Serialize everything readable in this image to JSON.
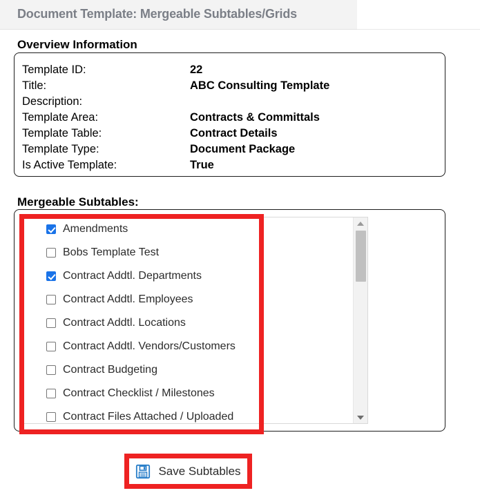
{
  "header": {
    "title": "Document Template: Mergeable Subtables/Grids"
  },
  "overview": {
    "legend": "Overview Information",
    "rows": [
      {
        "label": "Template ID:",
        "value": "22"
      },
      {
        "label": "Title:",
        "value": "ABC Consulting Template"
      },
      {
        "label": "Description:",
        "value": ""
      },
      {
        "label": "Template Area:",
        "value": "Contracts & Committals"
      },
      {
        "label": "Template Table:",
        "value": "Contract Details"
      },
      {
        "label": "Template Type:",
        "value": "Document Package"
      },
      {
        "label": "Is Active Template:",
        "value": "True"
      }
    ]
  },
  "subtables": {
    "legend": "Mergeable Subtables:",
    "items": [
      {
        "label": "Amendments",
        "checked": true
      },
      {
        "label": "Bobs Template Test",
        "checked": false
      },
      {
        "label": "Contract Addtl. Departments",
        "checked": true
      },
      {
        "label": "Contract Addtl. Employees",
        "checked": false
      },
      {
        "label": "Contract Addtl. Locations",
        "checked": false
      },
      {
        "label": "Contract Addtl. Vendors/Customers",
        "checked": false
      },
      {
        "label": "Contract Budgeting",
        "checked": false
      },
      {
        "label": "Contract Checklist / Milestones",
        "checked": false
      },
      {
        "label": "Contract Files Attached / Uploaded",
        "checked": false
      }
    ],
    "scrollbar": {
      "up_icon": "triangle-up-icon",
      "down_icon": "triangle-down-icon"
    }
  },
  "actions": {
    "save_label": "Save Subtables",
    "save_icon": "floppy-disk-save-icon"
  },
  "colors": {
    "accent_blue": "#1a73e8",
    "annotation_red": "#ee2222",
    "icon_blue": "#2a7fc9",
    "header_text": "#7b7f87",
    "header_band": "#f3f3f3"
  }
}
